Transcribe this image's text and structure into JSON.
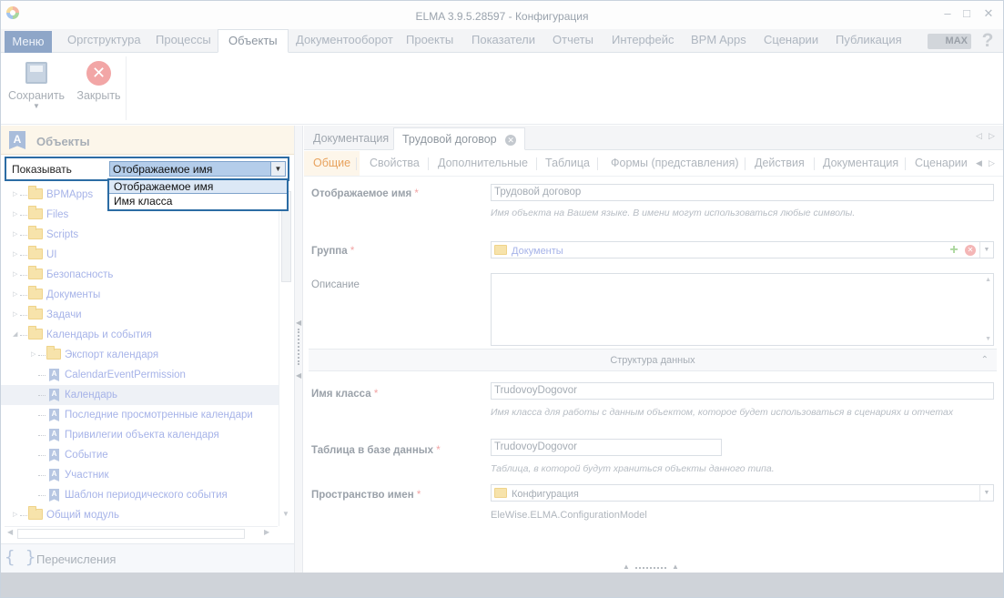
{
  "window": {
    "title": "ELMA 3.9.5.28597 - Конфигурация",
    "minimize": "–",
    "maximize": "□",
    "close": "✕"
  },
  "menubar": {
    "menu_label": "Меню",
    "tabs": [
      {
        "label": "Оргструктура"
      },
      {
        "label": "Процессы"
      },
      {
        "label": "Объекты"
      },
      {
        "label": "Документооборот"
      },
      {
        "label": "Проекты"
      },
      {
        "label": "Показатели"
      },
      {
        "label": "Отчеты"
      },
      {
        "label": "Интерфейс"
      },
      {
        "label": "BPM Apps"
      },
      {
        "label": "Сценарии"
      },
      {
        "label": "Публикация"
      }
    ],
    "max_badge": "MAX",
    "help": "?"
  },
  "ribbon": {
    "save_label": "Сохранить",
    "close_label": "Закрыть",
    "close_glyph": "✕",
    "more_arrow": "▼"
  },
  "left_panel": {
    "title": "Объекты",
    "title_icon": "A",
    "show_label": "Показывать",
    "show_value": "Отображаемое имя",
    "dropdown_options": [
      "Отображаемое имя",
      "Имя класса"
    ],
    "tree": [
      {
        "label": "BPMApps",
        "type": "folder"
      },
      {
        "label": "Files",
        "type": "folder"
      },
      {
        "label": "Scripts",
        "type": "folder"
      },
      {
        "label": "UI",
        "type": "folder"
      },
      {
        "label": "Безопасность",
        "type": "folder"
      },
      {
        "label": "Документы",
        "type": "folder"
      },
      {
        "label": "Задачи",
        "type": "folder"
      },
      {
        "label": "Календарь и события",
        "type": "folder"
      },
      {
        "label": "Экспорт календаря",
        "type": "folder"
      },
      {
        "label": "CalendarEventPermission",
        "type": "class"
      },
      {
        "label": "Календарь",
        "type": "class"
      },
      {
        "label": "Последние просмотренные календари",
        "type": "class"
      },
      {
        "label": "Привилегии объекта календаря",
        "type": "class"
      },
      {
        "label": "Событие",
        "type": "class"
      },
      {
        "label": "Участник",
        "type": "class"
      },
      {
        "label": "Шаблон периодического события",
        "type": "class"
      },
      {
        "label": "Общий модуль",
        "type": "folder"
      }
    ],
    "enum_icon": "{ }",
    "enum_label": "Перечисления"
  },
  "document_tabs": [
    {
      "label": "Документация"
    },
    {
      "label": "Трудовой договор",
      "close": "✕"
    }
  ],
  "sub_tabs": [
    {
      "label": "Общие"
    },
    {
      "label": "Свойства"
    },
    {
      "label": "Дополнительные"
    },
    {
      "label": "Таблица"
    },
    {
      "label": "Формы (представления)"
    },
    {
      "label": "Действия"
    },
    {
      "label": "Документация"
    },
    {
      "label": "Сценарии"
    }
  ],
  "form": {
    "display_name": {
      "label": "Отображаемое имя",
      "value": "Трудовой договор",
      "hint": "Имя объекта на Вашем языке. В имени могут использоваться любые символы."
    },
    "group": {
      "label": "Группа",
      "value": "Документы"
    },
    "description": {
      "label": "Описание"
    },
    "section": "Структура данных",
    "class_name": {
      "label": "Имя класса",
      "value": "TrudovoyDogovor",
      "hint": "Имя класса для работы с данным объектом, которое будет использоваться в сценариях и отчетах"
    },
    "db_table": {
      "label": "Таблица в базе данных",
      "value": "TrudovoyDogovor",
      "hint": "Таблица, в которой будут храниться объекты данного типа."
    },
    "namespace": {
      "label": "Пространство имен",
      "value": "Конфигурация",
      "full": "EleWise.ELMA.ConfigurationModel"
    },
    "required_mark": "*"
  }
}
